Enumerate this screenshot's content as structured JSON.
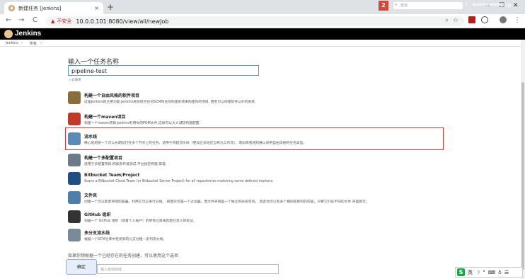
{
  "browser": {
    "tab_title": "新建任务 [Jenkins]",
    "tab_close": "×",
    "new_tab": "+",
    "minimize": "—",
    "maximize": "☐",
    "close": "✕",
    "back": "←",
    "forward": "→",
    "reload": "C",
    "warning_icon": "▲",
    "insecure_label": "不安全",
    "url": "10.0.0.101:8080/view/all/newJob"
  },
  "jenkins": {
    "title": "Jenkins",
    "notification_count": "2",
    "search_placeholder": "查找",
    "help": "?",
    "user": "jenkinsadmin",
    "logout": "| 注销"
  },
  "breadcrumb": {
    "items": [
      "Jenkins",
      "所有"
    ]
  },
  "form": {
    "heading": "输入一个任务名称",
    "name_value": "pipeline-test",
    "required_hint": "» 必填项"
  },
  "job_types": [
    {
      "name": "构建一个自由风格的软件项目",
      "desc": "这是Jenkins的主要功能.Jenkins将会结合任何SCM和任何构建系统来构建你的项目, 甚至可以构建软件以外的系统.",
      "icon_color": "#8a6d3b"
    },
    {
      "name": "构建一个maven项目",
      "desc": "构建一个maven项目.Jenkins利用你的POM文件,这样可以大大减轻构建配置.",
      "icon_color": "#c0392b"
    },
    {
      "name": "流水线",
      "desc": "精心地组织一个可以长期运行在多个节点上的任务。适用于构建流水线（更加正式地应当称为工作流），增加或者组织难以采用自由风格的任务类型。",
      "icon_color": "#5b8ab5"
    },
    {
      "name": "构建一个多配置项目",
      "desc": "适用于多配置项目,例如多环境测试,平台指定构建,等等.",
      "icon_color": "#6c7a89"
    },
    {
      "name": "Bitbucket Team/Project",
      "desc": "Scans a Bitbucket Cloud Team (or Bitbucket Server Project) for all repositories matching some defined markers.",
      "icon_color": "#205081"
    },
    {
      "name": "文件夹",
      "desc": "创建一个可以嵌套存储的容器。利用它可以进行分组。 视图仅仅是一个过滤器，而文件夹则是一个独立的命名空间， 因此你可以有多个相同名称的的内容，只要它们在不同的文件 夹里即可。",
      "icon_color": "#4f7ea8"
    },
    {
      "name": "GitHub 组织",
      "desc": "扫描一个 GitHub 组织（或者个人账户）的所有仓库来匹配已定义的标记。",
      "icon_color": "#333333"
    },
    {
      "name": "多分支流水线",
      "desc": "根据一个SCM仓库中检测到的分支创建一系列流水线。",
      "icon_color": "#7a8a99"
    }
  ],
  "copy": {
    "text": "如果你想根据一个已经存在的任务创建，可以使用这个选项",
    "ok_button": "确定",
    "input_placeholder": "输入自动完成"
  },
  "ime": {
    "logo": "S",
    "lang": "英",
    "icons": [
      "☽",
      "°",
      "⌨",
      "♁",
      "☰"
    ]
  }
}
